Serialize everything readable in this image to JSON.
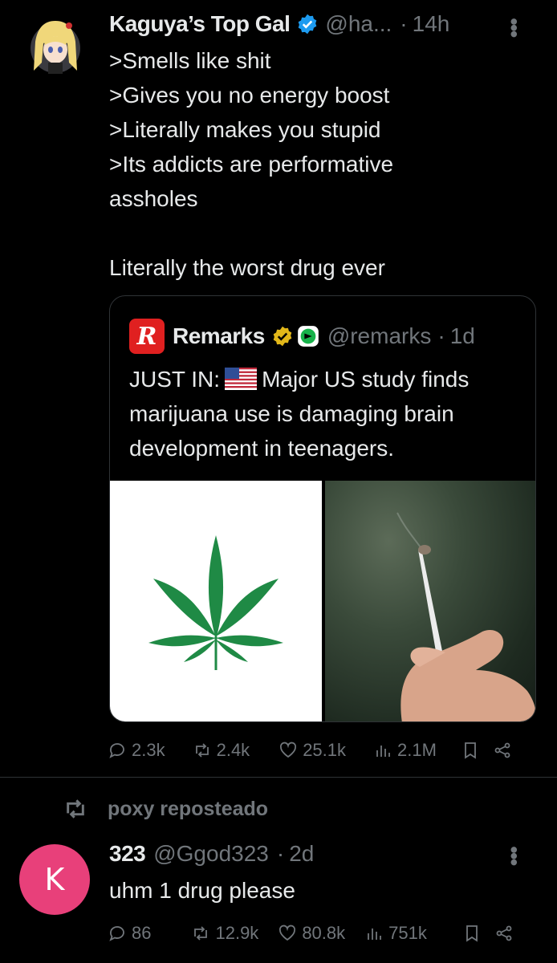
{
  "tweet1": {
    "name": "Kaguya’s Top Gal",
    "handle": "@ha...",
    "dot": "·",
    "time": "14h",
    "text": ">Smells like shit\n>Gives you no energy boost\n>Literally makes you stupid\n>Its addicts are performative\nassholes\n\nLiterally the worst drug ever",
    "quote": {
      "logo": "R",
      "name": "Remarks",
      "handle": "@remarks",
      "dot": "·",
      "time": "1d",
      "text_pre": "JUST IN:",
      "text_post": "Major US study finds marijuana use is damaging brain development in teenagers."
    },
    "stats": {
      "replies": "2.3k",
      "reposts": "2.4k",
      "likes": "25.1k",
      "views": "2.1M"
    }
  },
  "repost_banner": {
    "label": "poxy reposteado"
  },
  "tweet2": {
    "avatar_letter": "K",
    "name": "323",
    "handle": "@Ggod323",
    "dot": "·",
    "time": "2d",
    "text": "uhm 1 drug please",
    "stats": {
      "replies": "86",
      "reposts": "12.9k",
      "likes": "80.8k",
      "views": "751k"
    }
  },
  "colors": {
    "background": "#000000",
    "text": "#e7e9ea",
    "muted": "#71767b",
    "verified_blue": "#1d9bf0",
    "verified_gold": "#e2b719",
    "avatar_k": "#e8407a",
    "remarks_red": "#e02020",
    "leaf_green": "#1f8a45"
  },
  "icons": [
    "verified-badge-icon",
    "reply-icon",
    "repost-icon",
    "like-icon",
    "views-icon",
    "bookmark-icon",
    "share-icon",
    "more-icon",
    "us-flag-icon"
  ]
}
